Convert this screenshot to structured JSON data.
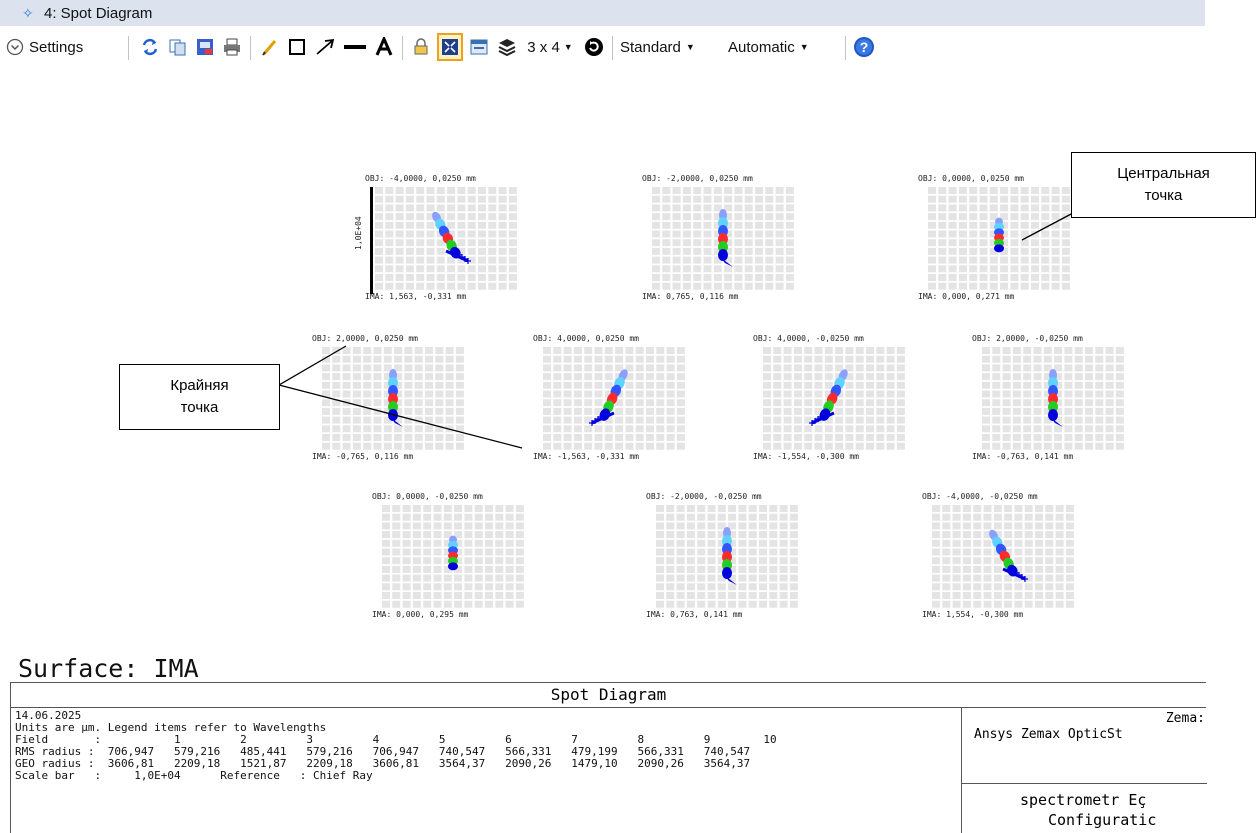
{
  "window": {
    "title": "4: Spot Diagram"
  },
  "toolbar": {
    "settings_label": "Settings",
    "layout_label": "3 x 4",
    "standard_label": "Standard",
    "automatic_label": "Automatic"
  },
  "spots": [
    {
      "obj": "OBJ: -4,0000, 0,0250 mm",
      "ima": "IMA: 1,563, -0,331 mm",
      "shape": "tiltR",
      "cross": true
    },
    {
      "obj": "OBJ: -2,0000, 0,0250 mm",
      "ima": "IMA: 0,765, 0,116 mm",
      "shape": "vertTail",
      "cross": false
    },
    {
      "obj": "OBJ: 0,0000, 0,0250 mm",
      "ima": "IMA: 0,000, 0,271 mm",
      "shape": "small",
      "cross": false
    },
    {
      "obj": "OBJ: 2,0000, 0,0250 mm",
      "ima": "IMA: -0,765, 0,116 mm",
      "shape": "vert",
      "cross": false
    },
    {
      "obj": "OBJ: 4,0000, 0,0250 mm",
      "ima": "IMA: -1,563, -0,331 mm",
      "shape": "tiltL",
      "cross": true
    },
    {
      "obj": "OBJ: 4,0000, -0,0250 mm",
      "ima": "IMA: -1,554, -0,300 mm",
      "shape": "tiltL",
      "cross": true
    },
    {
      "obj": "OBJ: 2,0000, -0,0250 mm",
      "ima": "IMA: -0,763, 0,141 mm",
      "shape": "vert",
      "cross": false
    },
    {
      "obj": "OBJ: 0,0000, -0,0250 mm",
      "ima": "IMA: 0,000, 0,295 mm",
      "shape": "small",
      "cross": false
    },
    {
      "obj": "OBJ: -2,0000, -0,0250 mm",
      "ima": "IMA: 0,763, 0,141 mm",
      "shape": "vertTail",
      "cross": false
    },
    {
      "obj": "OBJ: -4,0000, -0,0250 mm",
      "ima": "IMA: 1,554, -0,300 mm",
      "shape": "tiltR",
      "cross": true
    }
  ],
  "scale_bar_label": "1,0E+04",
  "callouts": {
    "center": {
      "line1": "Центральная",
      "line2": "точка"
    },
    "edge": {
      "line1": "Крайняя",
      "line2": "точка"
    }
  },
  "wavelength_colors": [
    "#8aa0ff",
    "#5fd2ff",
    "#3355ff",
    "#ff2a2a",
    "#22cc22",
    "#0000dd"
  ],
  "surface_label": "Surface: IMA",
  "report": {
    "title": "Spot Diagram",
    "date": "14.06.2025",
    "units_line": "Units are µm. Legend items refer to Wavelengths",
    "field_line": "Field       :           1         2         3         4         5         6         7         8         9        10",
    "rms_line": "RMS radius :  706,947   579,216   485,441   579,216   706,947   740,547   566,331   479,199   566,331   740,547",
    "geo_line": "GEO radius :  3606,81   2209,18   1521,87   2209,18   3606,81   3564,37   2090,26   1479,10   2090,26   3564,37",
    "scale_line": "Scale bar   :     1,0E+04      Reference   : Chief Ray",
    "right_top_1": "Zema:",
    "right_top_2": "Ansys Zemax OpticSt",
    "right_bot_1": "spectrometr Eç",
    "right_bot_2": "Configuratic"
  }
}
